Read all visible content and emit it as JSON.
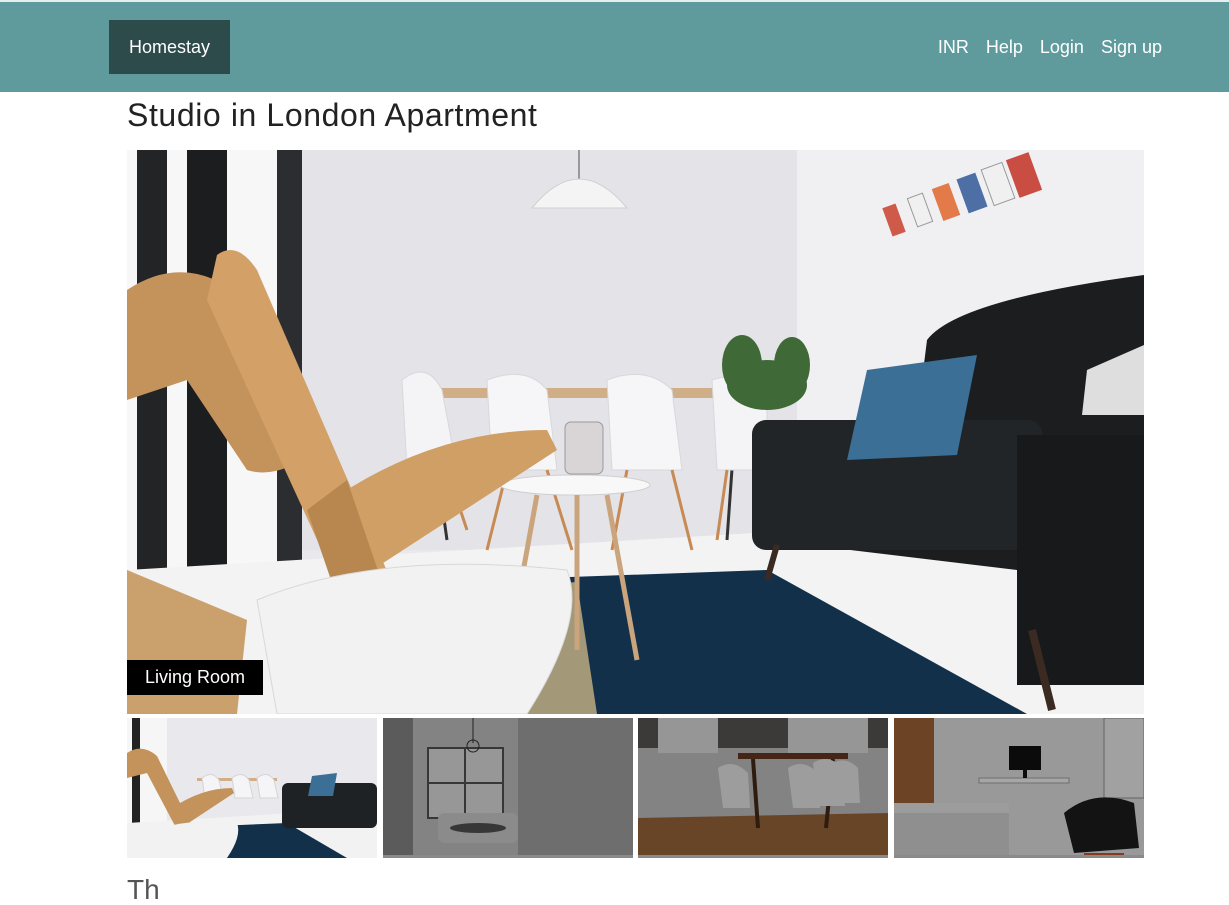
{
  "navbar": {
    "brand": "Homestay",
    "links": [
      "INR",
      "Help",
      "Login",
      "Sign up"
    ]
  },
  "listing": {
    "title": "Studio in London Apartment",
    "main_photo_caption": "Living Room",
    "description_start": "Th"
  },
  "colors": {
    "navbar_bg": "#5f9b9d",
    "brand_bg": "#2e4b4b",
    "caption_bg": "#000000"
  }
}
